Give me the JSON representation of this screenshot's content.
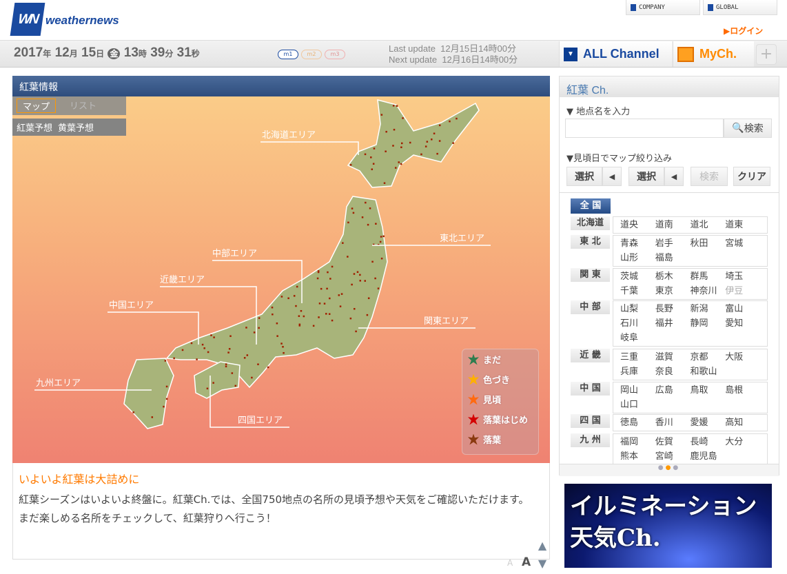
{
  "header": {
    "logo_text": "WN",
    "brand": "weathernews",
    "links": [
      "COMPANY",
      "GLOBAL"
    ],
    "login": "ログイン"
  },
  "datebar": {
    "year": "2017",
    "y": "年",
    "month": "12",
    "m": "月",
    "day": "15",
    "d": "日",
    "weekday": "金",
    "hour": "13",
    "h": "時",
    "minute": "39",
    "mi": "分",
    "second": "31",
    "s": "秒",
    "modes": [
      "m1",
      "m2",
      "m3"
    ],
    "last_update": "Last update  12月15日14時00分",
    "next_update": "Next update  12月16日14時00分",
    "all_channel": "ALL Channel",
    "mych": "MyCh.",
    "plus": "+"
  },
  "map": {
    "title": "紅葉情報",
    "view_tabs": [
      "マップ",
      "リスト"
    ],
    "forecast_tabs": [
      "紅葉予想",
      "黄葉予想"
    ],
    "areas": [
      "北海道エリア",
      "東北エリア",
      "中部エリア",
      "近畿エリア",
      "中国エリア",
      "関東エリア",
      "九州エリア",
      "四国エリア"
    ],
    "legend": [
      {
        "label": "まだ",
        "color": "#2e7d4f"
      },
      {
        "label": "色づき",
        "color": "#ffb000"
      },
      {
        "label": "見頃",
        "color": "#ff6a10"
      },
      {
        "label": "落葉はじめ",
        "color": "#d40000"
      },
      {
        "label": "落葉",
        "color": "#8a3a10"
      }
    ],
    "land_color": "#a8b47a",
    "dot_color": "#a02000"
  },
  "news": {
    "headline": "いよいよ紅葉は大詰めに",
    "body": "紅葉シーズンはいよいよ終盤に。紅葉Ch.では、全国750地点の名所の見頃予想や天気をご確認いただけます。まだ楽しめる名所をチェックして、紅葉狩りへ行こう！",
    "font_small": "A",
    "font_large": "A"
  },
  "side": {
    "title": "紅葉 Ch.",
    "search_label": "▼ 地点名を入力",
    "search_placeholder": "",
    "search_button": "検索",
    "filter_label": "▼見頃日でマップ絞り込み",
    "select1": "選択",
    "select2": "選択",
    "filter_search": "検索",
    "clear": "クリア",
    "all": "全 国",
    "regions": [
      {
        "name": "北海道",
        "items": [
          "道央",
          "道南",
          "道北",
          "道東"
        ]
      },
      {
        "name": "東 北",
        "items": [
          "青森",
          "岩手",
          "秋田",
          "宮城",
          "山形",
          "福島"
        ]
      },
      {
        "name": "関 東",
        "items": [
          "茨城",
          "栃木",
          "群馬",
          "埼玉",
          "千葉",
          "東京",
          "神奈川",
          "伊豆"
        ]
      },
      {
        "name": "中 部",
        "items": [
          "山梨",
          "長野",
          "新潟",
          "富山",
          "石川",
          "福井",
          "静岡",
          "愛知",
          "岐阜"
        ]
      },
      {
        "name": "近 畿",
        "items": [
          "三重",
          "滋賀",
          "京都",
          "大阪",
          "兵庫",
          "奈良",
          "和歌山"
        ]
      },
      {
        "name": "中 国",
        "items": [
          "岡山",
          "広島",
          "鳥取",
          "島根",
          "山口"
        ]
      },
      {
        "name": "四 国",
        "items": [
          "徳島",
          "香川",
          "愛媛",
          "高知"
        ]
      },
      {
        "name": "九 州",
        "items": [
          "福岡",
          "佐賀",
          "長崎",
          "大分",
          "熊本",
          "宮崎",
          "鹿児島"
        ]
      }
    ]
  },
  "banner": {
    "line1": "イルミネーション",
    "line2": "天気Ch."
  }
}
